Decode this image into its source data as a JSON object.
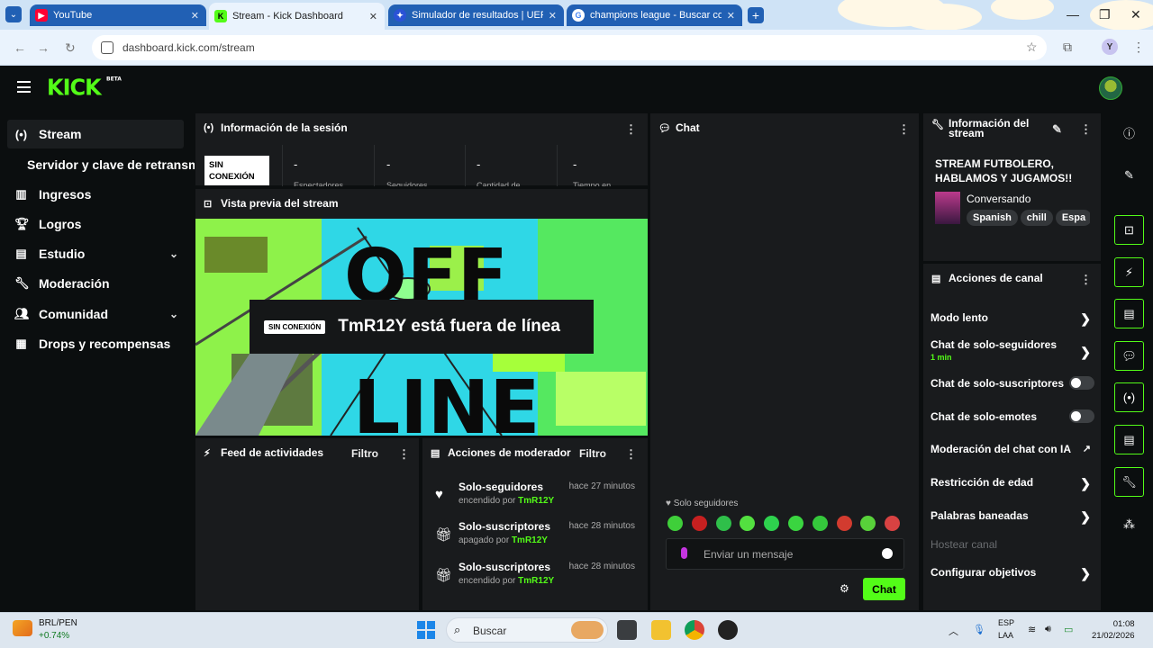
{
  "browser": {
    "tabs": [
      {
        "title": "YouTube",
        "favicon": "youtube-icon",
        "active": false
      },
      {
        "title": "Stream - Kick Dashboard",
        "favicon": "kick-icon",
        "active": true
      },
      {
        "title": "Simulador de resultados | UEFA",
        "favicon": "uefa-icon",
        "active": false
      },
      {
        "title": "champions league - Buscar con Google",
        "favicon": "google-icon",
        "active": false
      }
    ],
    "url": "dashboard.kick.com/stream",
    "profile_initial": "Y"
  },
  "header": {
    "logo": "KICK",
    "logo_badge": "BETA"
  },
  "sidebar": {
    "items": [
      {
        "label": "Stream",
        "icon": "broadcast-icon"
      },
      {
        "label": "Servidor y clave de retransmisión",
        "icon": ""
      },
      {
        "label": "Ingresos",
        "icon": "revenue-icon"
      },
      {
        "label": "Logros",
        "icon": "trophy-icon"
      },
      {
        "label": "Estudio",
        "icon": "studio-icon"
      },
      {
        "label": "Moderación",
        "icon": "wrench-icon"
      },
      {
        "label": "Comunidad",
        "icon": "community-icon"
      },
      {
        "label": "Drops y recompensas",
        "icon": "drops-icon"
      }
    ]
  },
  "session": {
    "title": "Información de la sesión",
    "badge": "SIN CONEXIÓN",
    "stats": [
      {
        "value": "-",
        "label": "Espectadores"
      },
      {
        "value": "-",
        "label": "Seguidores"
      },
      {
        "value": "-",
        "label": "Cantidad de"
      },
      {
        "value": "-",
        "label": "Tiempo en"
      }
    ]
  },
  "preview": {
    "title": "Vista previa del stream",
    "tag": "SIN CONEXIÓN",
    "message": "TmR12Y está fuera de línea"
  },
  "activity": {
    "title": "Feed de actividades",
    "filter": "Filtro"
  },
  "modactions": {
    "title": "Acciones de moderador",
    "filter": "Filtro",
    "items": [
      {
        "icon": "heart-icon",
        "title": "Solo-seguidores",
        "time": "hace 27 minutos",
        "state": "encendido por",
        "user": "TmR12Y"
      },
      {
        "icon": "gift-icon",
        "title": "Solo-suscriptores",
        "time": "hace 28 minutos",
        "state": "apagado por",
        "user": "TmR12Y"
      },
      {
        "icon": "gift-icon",
        "title": "Solo-suscriptores",
        "time": "hace 28 minutos",
        "state": "encendido por",
        "user": "TmR12Y"
      }
    ]
  },
  "chat": {
    "title": "Chat",
    "mode_label": "Solo seguidores",
    "placeholder": "Enviar un mensaje",
    "send_label": "Chat",
    "emote_colors": [
      "#3fcf3a",
      "#c72020",
      "#2fbf4a",
      "#53e040",
      "#2ed24e",
      "#3ad540",
      "#35c83c",
      "#d23b2f",
      "#58d13a",
      "#d84242"
    ]
  },
  "stream_info": {
    "title": "Información del stream",
    "stream_title": "STREAM FUTBOLERO, HABLAMOS Y JUGAMOS!!",
    "category": "Conversando",
    "tags": [
      "Spanish",
      "chill",
      "Espa"
    ]
  },
  "channel_actions": {
    "title": "Acciones de canal",
    "rows": [
      {
        "label": "Modo lento",
        "control": "chevron"
      },
      {
        "label": "Chat de solo-seguidores",
        "sub": "1 min",
        "control": "chevron"
      },
      {
        "label": "Chat de solo-suscriptores",
        "control": "toggle"
      },
      {
        "label": "Chat de solo-emotes",
        "control": "toggle"
      },
      {
        "label": "Moderación del chat con IA",
        "control": "external"
      },
      {
        "label": "Restricción de edad",
        "control": "chevron"
      },
      {
        "label": "Palabras baneadas",
        "control": "chevron"
      },
      {
        "label": "Hostear canal",
        "control": "none"
      },
      {
        "label": "Configurar objetivos",
        "control": "chevron"
      }
    ]
  },
  "taskbar": {
    "ticker": "BRL/PEN",
    "ticker_change": "+0.74%",
    "search_label": "Buscar",
    "lang1": "ESP",
    "lang2": "LAA",
    "time": "01:08",
    "date": "21/02/2026"
  }
}
